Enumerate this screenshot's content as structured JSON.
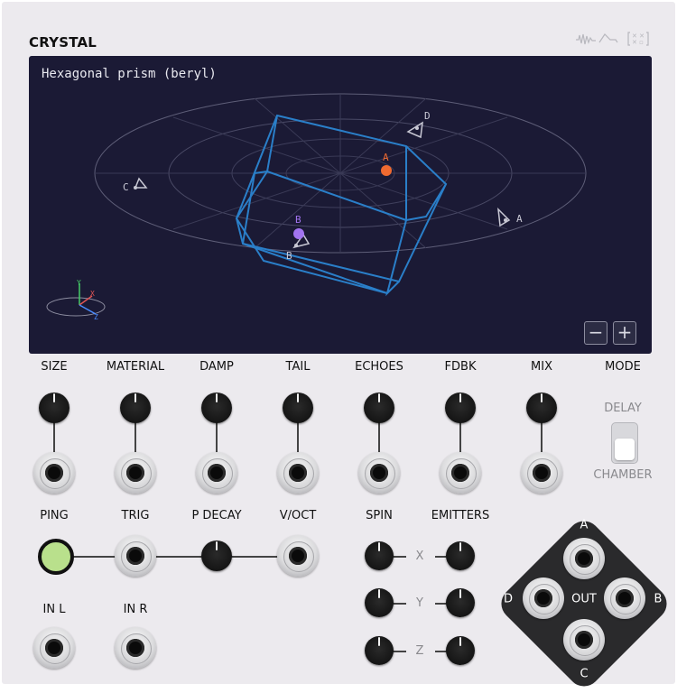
{
  "module": {
    "title": "CRYSTAL"
  },
  "display": {
    "shape_name": "Hexagonal prism (beryl)",
    "colors": {
      "background": "#1b1a35",
      "prism": "#2a7fc9",
      "emitter_a": "#f06a30",
      "emitter_b": "#a274f0",
      "grid": "#6c6c86"
    },
    "emitter_labels": {
      "a": "A",
      "b": "B"
    },
    "microphone_labels": {
      "a": "A",
      "b": "B",
      "c": "C",
      "d": "D"
    },
    "axes": {
      "x": "X",
      "y": "Y",
      "z": "Z"
    },
    "zoom_out_label": "−",
    "zoom_in_label": "+"
  },
  "row1": {
    "labels": [
      "SIZE",
      "MATERIAL",
      "DAMP",
      "TAIL",
      "ECHOES",
      "FDBK",
      "MIX",
      "MODE"
    ]
  },
  "mode_switch": {
    "top": "DELAY",
    "bottom": "CHAMBER"
  },
  "row2": {
    "labels": [
      "PING",
      "TRIG",
      "P DECAY",
      "V/OCT"
    ]
  },
  "ping_color": "#b9e08c",
  "spin": {
    "label": "SPIN"
  },
  "emitters": {
    "label": "EMITTERS"
  },
  "axes_labels": [
    "X",
    "Y",
    "Z"
  ],
  "inputs": {
    "left": "IN L",
    "right": "IN R"
  },
  "outputs": {
    "center": "OUT",
    "a": "A",
    "b": "B",
    "c": "C",
    "d": "D"
  }
}
